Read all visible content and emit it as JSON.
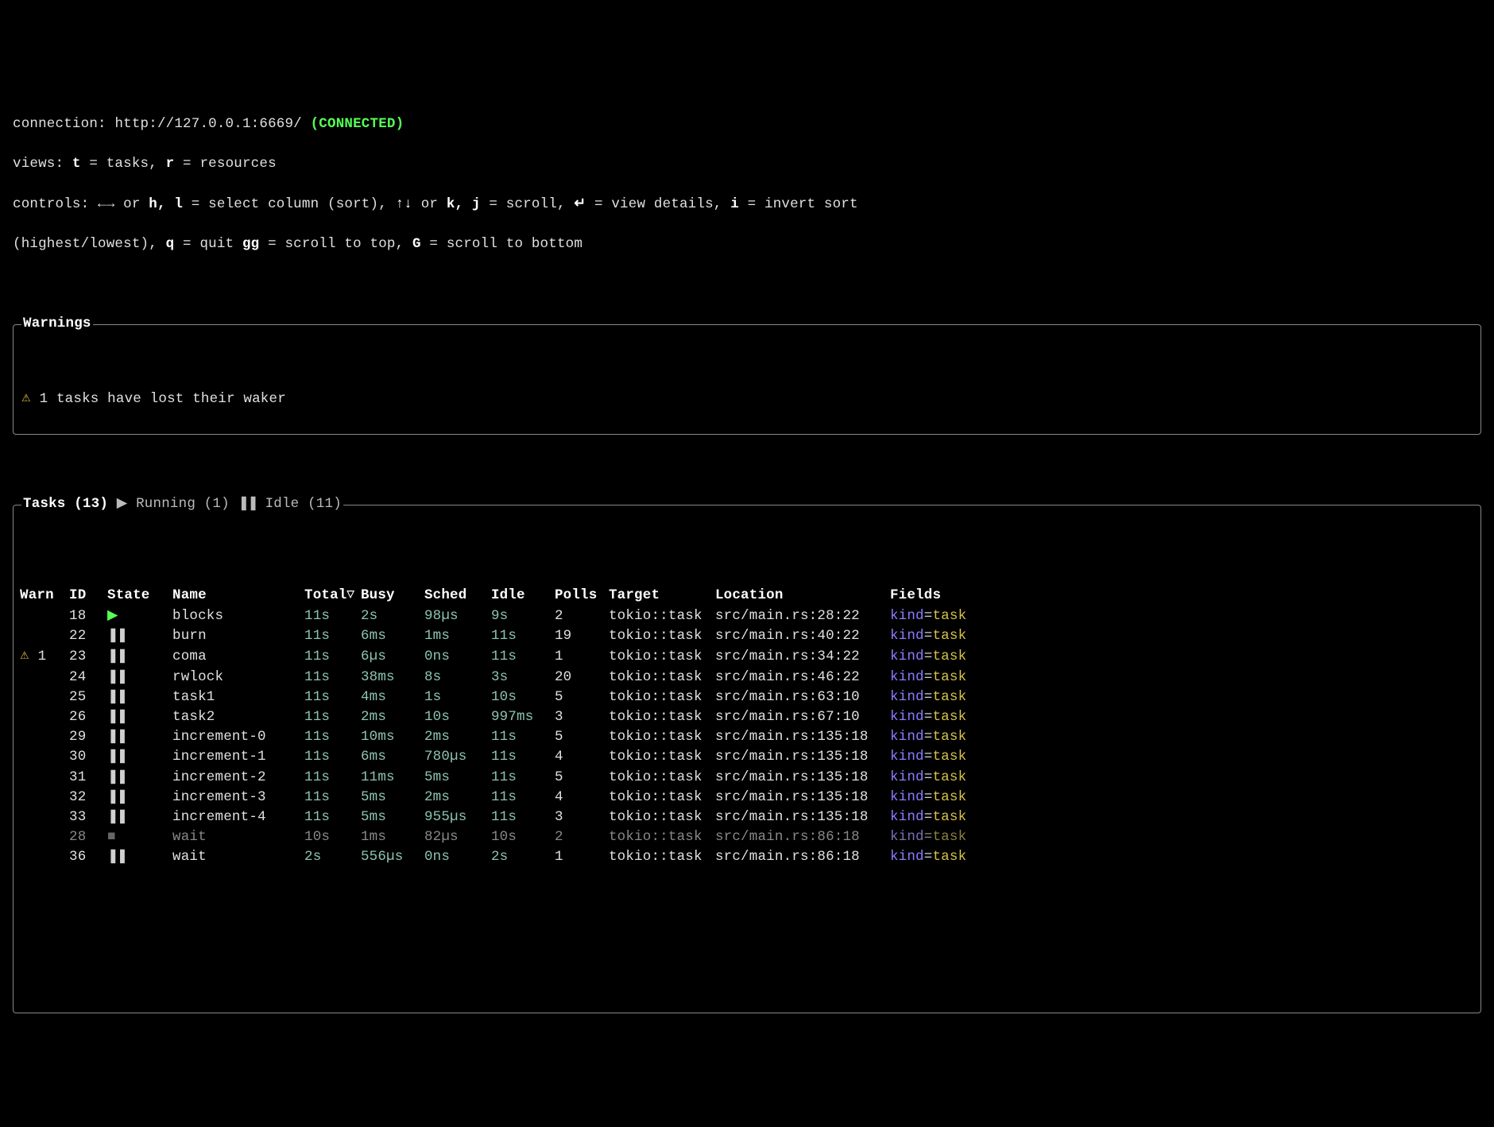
{
  "connection": {
    "label": "connection:",
    "url": "http://127.0.0.1:6669/",
    "status": "(CONNECTED)"
  },
  "views": {
    "label": "views:",
    "t_key": "t",
    "t_desc": " = tasks, ",
    "r_key": "r",
    "r_desc": " = resources"
  },
  "controls": {
    "label": "controls:",
    "arrows_lr": " ←→ or ",
    "hl": "h, l",
    "hl_desc": " = select column (sort), ",
    "arrows_ud": "↑↓",
    "or": " or ",
    "kj": "k, j",
    "kj_desc": " = scroll, ",
    "enter": "↵",
    "enter_desc": " = view details, ",
    "i": "i",
    "i_desc": " = invert sort",
    "line2_pre": "(highest/lowest), ",
    "q": "q",
    "q_desc": " = quit ",
    "gg": "gg",
    "gg_desc": " = scroll to top, ",
    "G": "G",
    "G_desc": " = scroll to bottom"
  },
  "warnings": {
    "title": "Warnings",
    "icon": "⚠",
    "text": "1 tasks have lost their waker"
  },
  "tasks_box": {
    "title_prefix": "Tasks (13)",
    "run_icon": "▶",
    "running_label": "Running (1)",
    "idle_icon": "❚❚",
    "idle_label": "Idle (11)"
  },
  "columns": {
    "warn": "Warn",
    "id": "ID",
    "state": "State",
    "name": "Name",
    "total": "Total",
    "busy": "Busy",
    "sched": "Sched",
    "idle": "Idle",
    "polls": "Polls",
    "target": "Target",
    "location": "Location",
    "fields": "Fields"
  },
  "field_kv": {
    "key": "kind",
    "eq": "=",
    "val": "task"
  },
  "rows": [
    {
      "warn": "",
      "id": "18",
      "state": "run",
      "name": "blocks",
      "total": "11s",
      "busy": "2s",
      "sched": "98µs",
      "idle": "9s",
      "polls": "2",
      "target": "tokio::task",
      "loc": "src/main.rs:28:22",
      "dim": false
    },
    {
      "warn": "",
      "id": "22",
      "state": "pause",
      "name": "burn",
      "total": "11s",
      "busy": "6ms",
      "sched": "1ms",
      "idle": "11s",
      "polls": "19",
      "target": "tokio::task",
      "loc": "src/main.rs:40:22",
      "dim": false
    },
    {
      "warn": "⚠ 1",
      "id": "23",
      "state": "pause",
      "name": "coma",
      "total": "11s",
      "busy": "6µs",
      "sched": "0ns",
      "idle": "11s",
      "polls": "1",
      "target": "tokio::task",
      "loc": "src/main.rs:34:22",
      "dim": false
    },
    {
      "warn": "",
      "id": "24",
      "state": "pause",
      "name": "rwlock",
      "total": "11s",
      "busy": "38ms",
      "sched": "8s",
      "idle": "3s",
      "polls": "20",
      "target": "tokio::task",
      "loc": "src/main.rs:46:22",
      "dim": false
    },
    {
      "warn": "",
      "id": "25",
      "state": "pause",
      "name": "task1",
      "total": "11s",
      "busy": "4ms",
      "sched": "1s",
      "idle": "10s",
      "polls": "5",
      "target": "tokio::task",
      "loc": "src/main.rs:63:10",
      "dim": false
    },
    {
      "warn": "",
      "id": "26",
      "state": "pause",
      "name": "task2",
      "total": "11s",
      "busy": "2ms",
      "sched": "10s",
      "idle": "997ms",
      "polls": "3",
      "target": "tokio::task",
      "loc": "src/main.rs:67:10",
      "dim": false
    },
    {
      "warn": "",
      "id": "29",
      "state": "pause",
      "name": "increment-0",
      "total": "11s",
      "busy": "10ms",
      "sched": "2ms",
      "idle": "11s",
      "polls": "5",
      "target": "tokio::task",
      "loc": "src/main.rs:135:18",
      "dim": false
    },
    {
      "warn": "",
      "id": "30",
      "state": "pause",
      "name": "increment-1",
      "total": "11s",
      "busy": "6ms",
      "sched": "780µs",
      "idle": "11s",
      "polls": "4",
      "target": "tokio::task",
      "loc": "src/main.rs:135:18",
      "dim": false
    },
    {
      "warn": "",
      "id": "31",
      "state": "pause",
      "name": "increment-2",
      "total": "11s",
      "busy": "11ms",
      "sched": "5ms",
      "idle": "11s",
      "polls": "5",
      "target": "tokio::task",
      "loc": "src/main.rs:135:18",
      "dim": false
    },
    {
      "warn": "",
      "id": "32",
      "state": "pause",
      "name": "increment-3",
      "total": "11s",
      "busy": "5ms",
      "sched": "2ms",
      "idle": "11s",
      "polls": "4",
      "target": "tokio::task",
      "loc": "src/main.rs:135:18",
      "dim": false
    },
    {
      "warn": "",
      "id": "33",
      "state": "pause",
      "name": "increment-4",
      "total": "11s",
      "busy": "5ms",
      "sched": "955µs",
      "idle": "11s",
      "polls": "3",
      "target": "tokio::task",
      "loc": "src/main.rs:135:18",
      "dim": false
    },
    {
      "warn": "",
      "id": "28",
      "state": "stop",
      "name": "wait",
      "total": "10s",
      "busy": "1ms",
      "sched": "82µs",
      "idle": "10s",
      "polls": "2",
      "target": "tokio::task",
      "loc": "src/main.rs:86:18",
      "dim": true
    },
    {
      "warn": "",
      "id": "36",
      "state": "pause",
      "name": "wait",
      "total": "2s",
      "busy": "556µs",
      "sched": "0ns",
      "idle": "2s",
      "polls": "1",
      "target": "tokio::task",
      "loc": "src/main.rs:86:18",
      "dim": false
    }
  ]
}
